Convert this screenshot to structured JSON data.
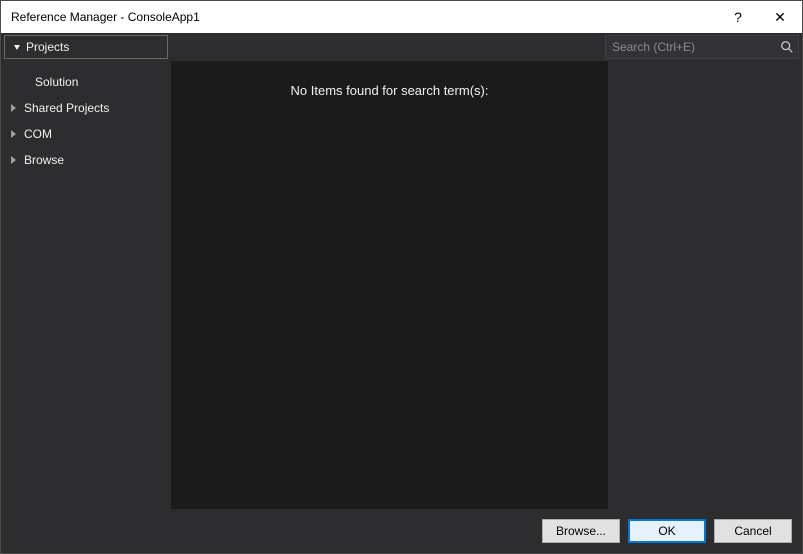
{
  "title": "Reference Manager - ConsoleApp1",
  "tabs": {
    "projects": "Projects"
  },
  "search": {
    "placeholder": "Search (Ctrl+E)"
  },
  "sidebar": {
    "solution": "Solution",
    "shared": "Shared Projects",
    "com": "COM",
    "browse": "Browse"
  },
  "main": {
    "empty_message": "No Items found for search term(s):"
  },
  "footer": {
    "browse": "Browse...",
    "ok": "OK",
    "cancel": "Cancel"
  }
}
